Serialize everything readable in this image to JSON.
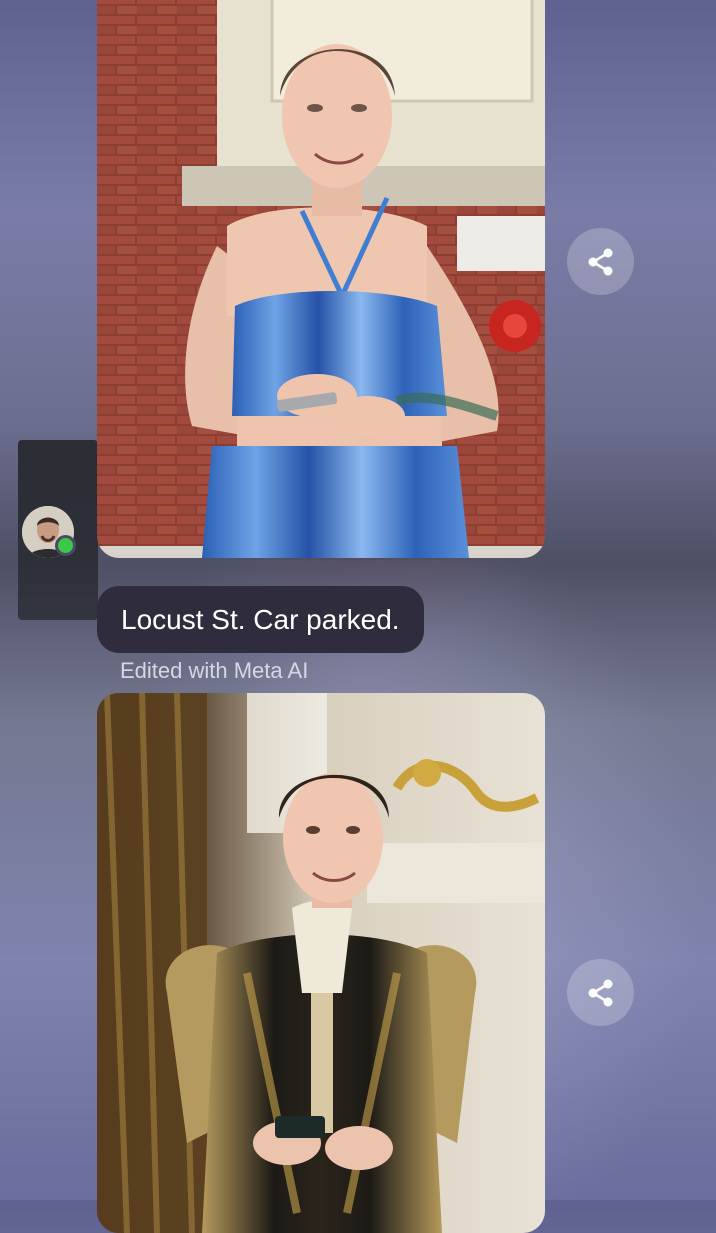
{
  "message": {
    "text": "Locust St. Car parked.",
    "edited_note": "Edited with Meta AI"
  },
  "icons": {
    "share": "share-icon",
    "avatar": "avatar",
    "online": "online-status-icon"
  },
  "colors": {
    "bubble_bg": "#2f2d3d",
    "online_dot": "#3ec84a",
    "edited_text": "#d7d6e4"
  }
}
